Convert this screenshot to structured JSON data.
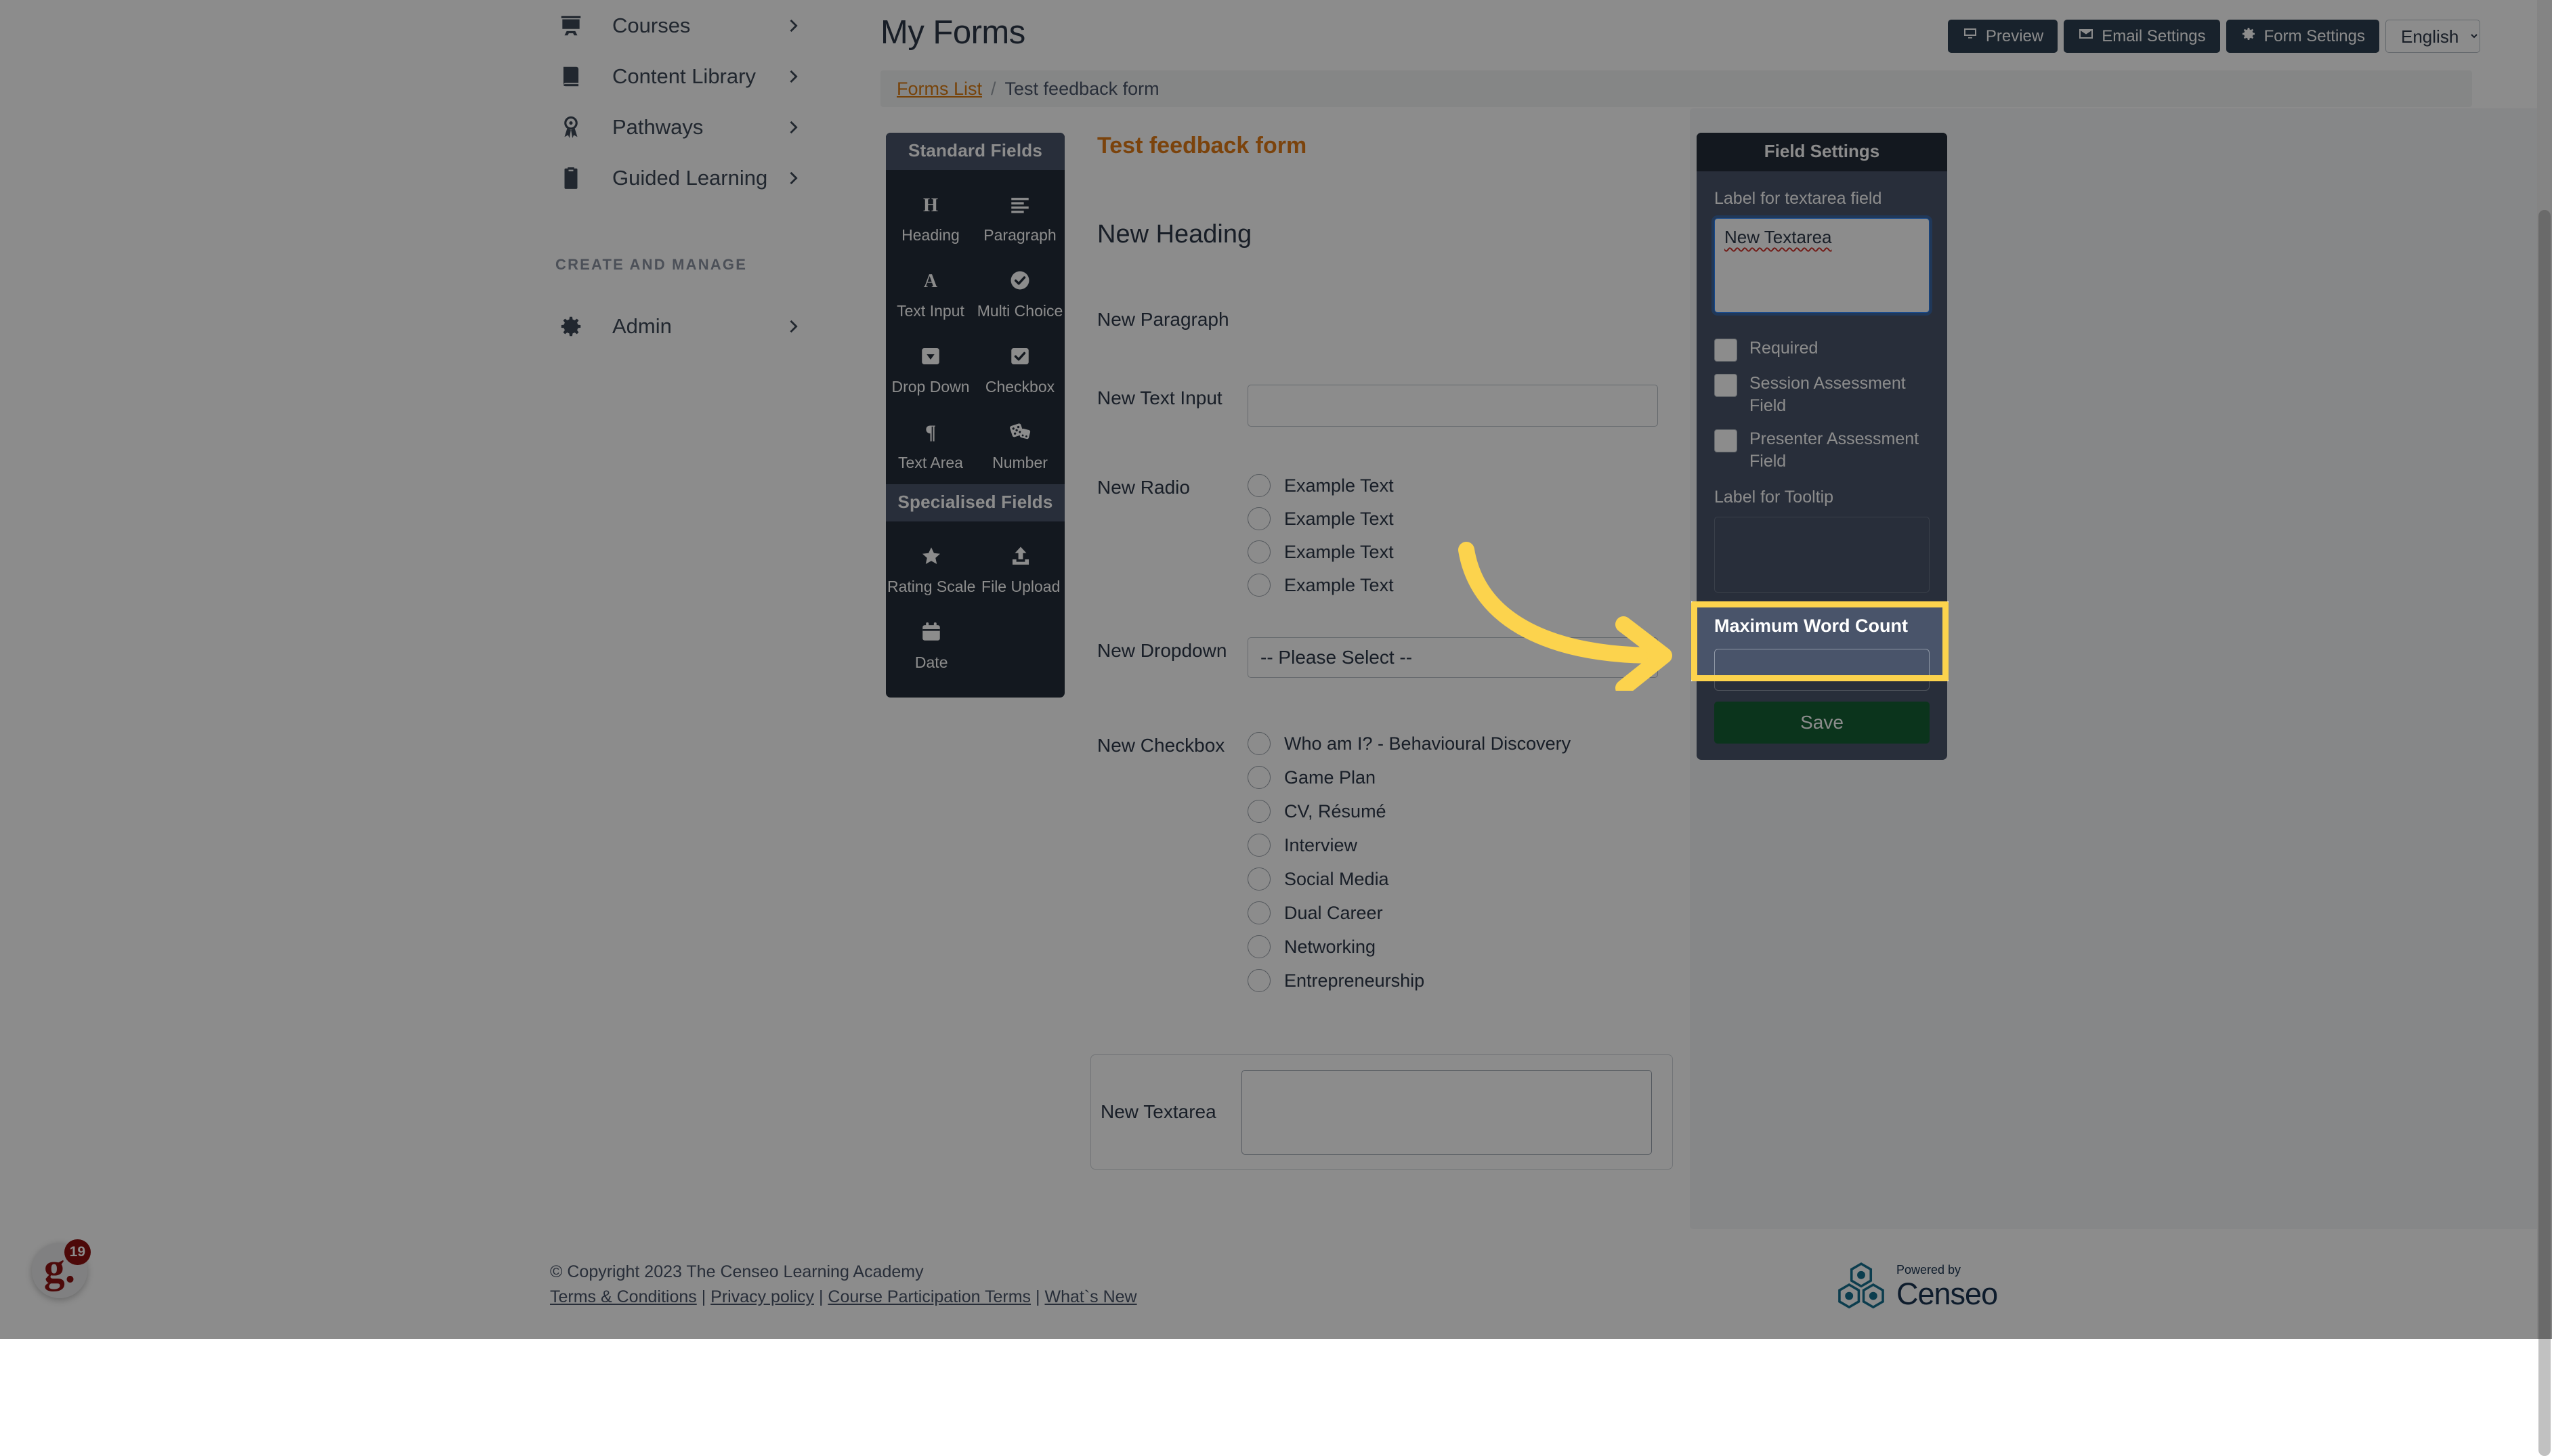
{
  "sidebar": {
    "items": [
      {
        "label": "Courses",
        "icon": "presentation-user-icon"
      },
      {
        "label": "Content Library",
        "icon": "book-icon"
      },
      {
        "label": "Pathways",
        "icon": "award-ribbon-icon"
      },
      {
        "label": "Guided Learning",
        "icon": "clipboard-list-icon"
      }
    ],
    "section_label": "CREATE AND MANAGE",
    "admin": {
      "label": "Admin",
      "icon": "gear-icon"
    }
  },
  "header": {
    "title": "My Forms",
    "toolbar": {
      "preview_label": "Preview",
      "email_settings_label": "Email Settings",
      "form_settings_label": "Form Settings",
      "language_selected": "English",
      "language_options": [
        "English"
      ]
    }
  },
  "breadcrumb": {
    "root_label": "Forms List",
    "separator": "/",
    "current_label": "Test feedback form"
  },
  "palette": {
    "standard_heading": "Standard Fields",
    "standard_items": [
      {
        "label": "Heading",
        "icon": "heading-h-icon"
      },
      {
        "label": "Paragraph",
        "icon": "paragraph-lines-icon"
      },
      {
        "label": "Text Input",
        "icon": "letter-a-icon"
      },
      {
        "label": "Multi Choice",
        "icon": "check-circle-icon"
      },
      {
        "label": "Drop Down",
        "icon": "caret-square-down-icon"
      },
      {
        "label": "Checkbox",
        "icon": "check-square-icon"
      },
      {
        "label": "Text Area",
        "icon": "pilcrow-icon"
      },
      {
        "label": "Number",
        "icon": "dice-icon"
      }
    ],
    "specialised_heading": "Specialised Fields",
    "specialised_items": [
      {
        "label": "Rating Scale",
        "icon": "star-icon"
      },
      {
        "label": "File Upload",
        "icon": "upload-icon"
      },
      {
        "label": "Date",
        "icon": "calendar-icon"
      }
    ]
  },
  "form": {
    "title": "Test feedback form",
    "heading_field": "New Heading",
    "paragraph_field": "New Paragraph",
    "text_input_label": "New Text Input",
    "text_input_value": "",
    "radio_label": "New Radio",
    "radio_options": [
      "Example Text",
      "Example Text",
      "Example Text",
      "Example Text"
    ],
    "dropdown_label": "New Dropdown",
    "dropdown_selected": "-- Please Select --",
    "checkbox_label": "New Checkbox",
    "checkbox_options": [
      "Who am I? - Behavioural Discovery",
      "Game Plan",
      "CV, Résumé",
      "Interview",
      "Social Media",
      "Dual Career",
      "Networking",
      "Entrepreneurship"
    ],
    "textarea_label": "New Textarea",
    "textarea_value": ""
  },
  "field_settings": {
    "panel_title": "Field Settings",
    "textarea_label_caption": "Label for textarea field",
    "textarea_label_value": "New Textarea",
    "checkboxes": [
      {
        "label": "Required",
        "checked": false
      },
      {
        "label": "Session Assessment Field",
        "checked": false
      },
      {
        "label": "Presenter Assessment Field",
        "checked": false
      }
    ],
    "tooltip_caption": "Label for Tooltip",
    "tooltip_value": "",
    "max_word_count_caption": "Maximum Word Count",
    "max_word_count_value": "",
    "save_label": "Save"
  },
  "footer": {
    "copyright": "© Copyright 2023 The Censeo Learning Academy",
    "links": [
      "Terms & Conditions",
      "Privacy policy",
      "Course Participation Terms",
      "What`s New"
    ],
    "link_separator": "|",
    "brand_small": "Powered by",
    "brand_name": "Censeo"
  },
  "chat_widget": {
    "logo_text": "g.",
    "badge_count": "19"
  },
  "colors": {
    "accent_orange": "#d97a12",
    "highlight_yellow": "#fcd34d",
    "panel_dark": "#232c39",
    "panel_slate": "#49546a",
    "save_green": "#156033",
    "brand_navy": "#1b3350",
    "chat_red": "#8c1111"
  }
}
